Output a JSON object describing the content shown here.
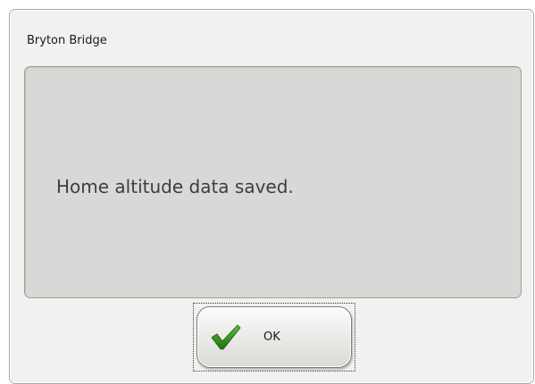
{
  "dialog": {
    "title": "Bryton Bridge",
    "message": "Home altitude data saved.",
    "ok_button": {
      "label": "OK",
      "icon": "checkmark-icon"
    }
  },
  "colors": {
    "dialog_background": "#f1f1ef",
    "panel_background": "#d8d8d6",
    "checkmark": "#2f8a1e"
  }
}
